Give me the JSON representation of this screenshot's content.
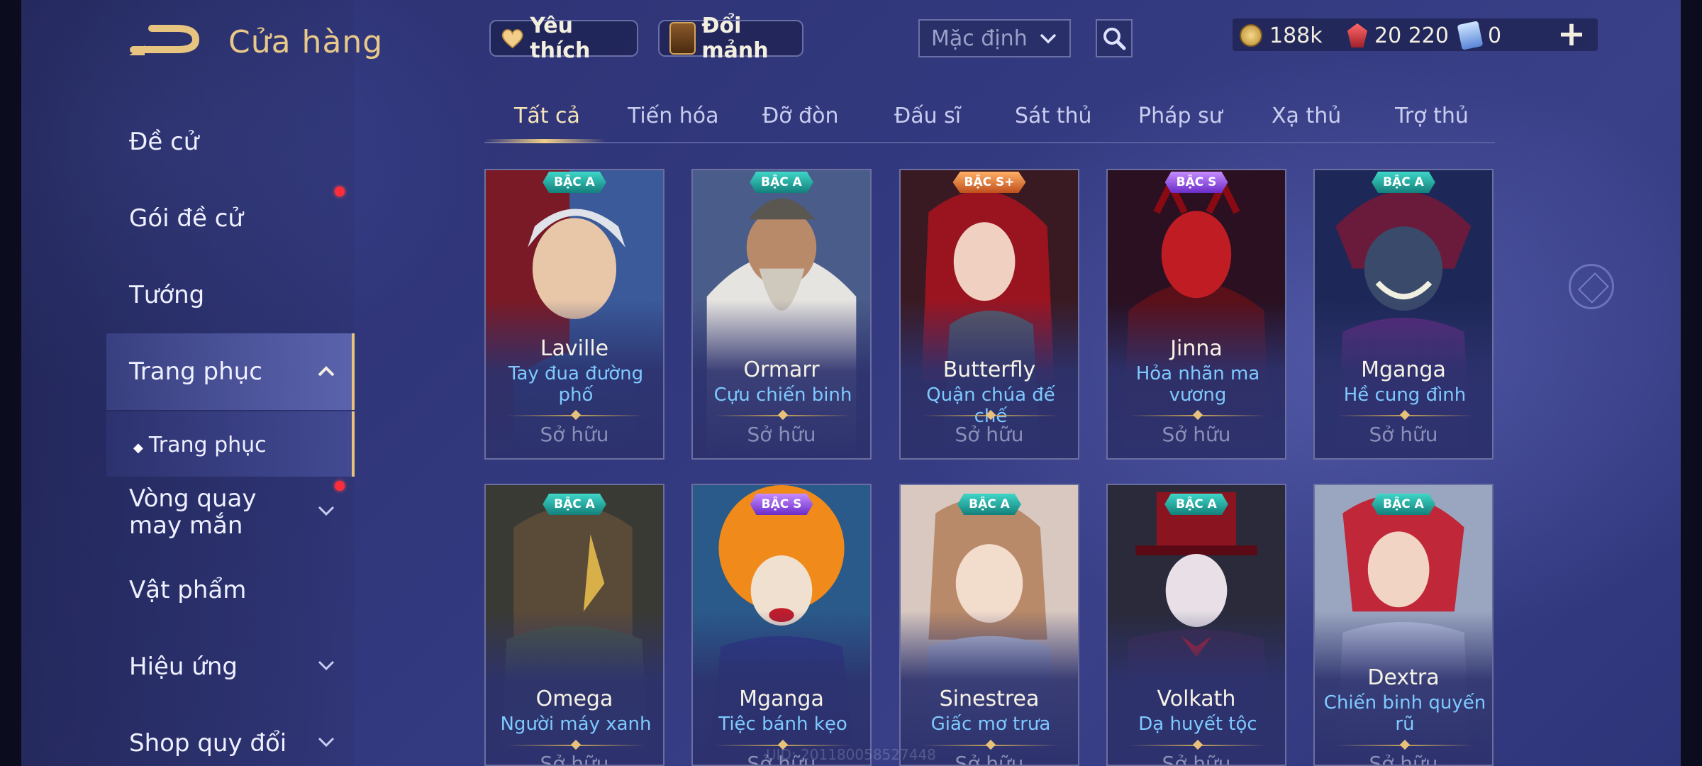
{
  "header": {
    "title": "Cửa hàng",
    "favorites_label": "Yêu thích",
    "shards_label": "Đổi mảnh",
    "sort_value": "Mặc định",
    "gold": "188k",
    "rubies": "20 220",
    "vouchers": "0"
  },
  "sidebar": {
    "items": [
      {
        "label": "Đề cử"
      },
      {
        "label": "Gói đề cử"
      },
      {
        "label": "Tướng"
      },
      {
        "label": "Trang phục"
      },
      {
        "label": "Trang phục"
      },
      {
        "label": "Vòng quay may mắn"
      },
      {
        "label": "Vật phẩm"
      },
      {
        "label": "Hiệu ứng"
      },
      {
        "label": "Shop quy đổi"
      }
    ]
  },
  "tabs": [
    "Tất cả",
    "Tiến hóa",
    "Đỡ đòn",
    "Đấu sĩ",
    "Sát thủ",
    "Pháp sư",
    "Xạ thủ",
    "Trợ thủ"
  ],
  "cards": [
    {
      "tier": "BẬC A",
      "hero": "Laville",
      "skin": "Tay đua đường phố",
      "status": "Sở hữu"
    },
    {
      "tier": "BẬC A",
      "hero": "Ormarr",
      "skin": "Cựu chiến binh",
      "status": "Sở hữu"
    },
    {
      "tier": "BẬC S+",
      "hero": "Butterfly",
      "skin": "Quận chúa đế chế",
      "status": "Sở hữu"
    },
    {
      "tier": "BẬC S",
      "hero": "Jinna",
      "skin": "Hỏa nhãn ma vương",
      "status": "Sở hữu"
    },
    {
      "tier": "BẬC A",
      "hero": "Mganga",
      "skin": "Hề cung đình",
      "status": "Sở hữu"
    },
    {
      "tier": "BẬC A",
      "hero": "Omega",
      "skin": "Người máy xanh",
      "status": "Sở hữu"
    },
    {
      "tier": "BẬC S",
      "hero": "Mganga",
      "skin": "Tiệc bánh kẹo",
      "status": "Sở hữu"
    },
    {
      "tier": "BẬC A",
      "hero": "Sinestrea",
      "skin": "Giấc mơ trưa",
      "status": "Sở hữu"
    },
    {
      "tier": "BẬC A",
      "hero": "Volkath",
      "skin": "Dạ huyết tộc",
      "status": "Sở hữu"
    },
    {
      "tier": "BẬC A",
      "hero": "Dextra",
      "skin": "Chiến binh quyến rũ",
      "status": "Sở hữu"
    }
  ],
  "uid": "UID: 201180058527448",
  "colors": {
    "accent": "#e8c27a",
    "skin_text": "#7ec9ff",
    "badge_dot": "#ff2c3c"
  }
}
